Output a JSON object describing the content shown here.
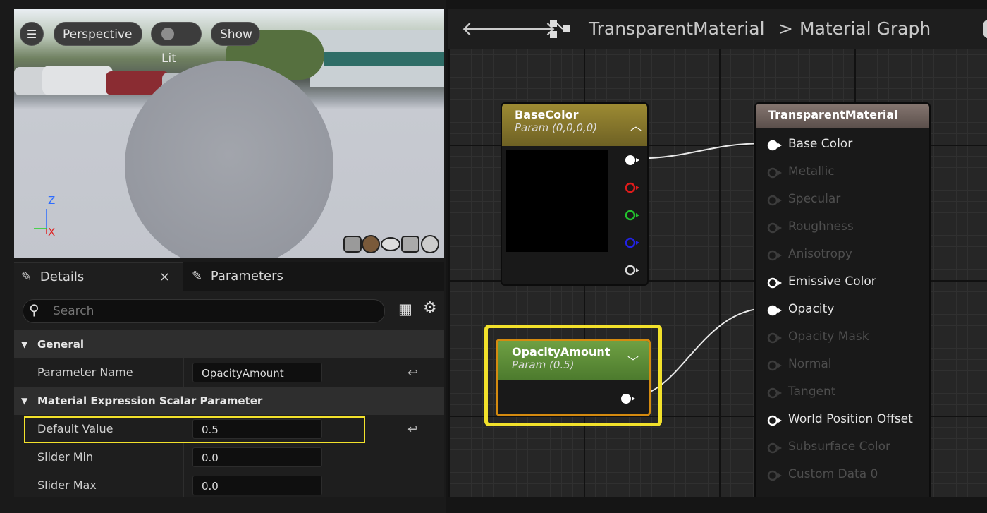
{
  "viewport": {
    "menu_icon": "hamburger-icon",
    "perspective_label": "Perspective",
    "lit_label": "Lit",
    "show_label": "Show",
    "axis_z": "Z",
    "axis_x": "X"
  },
  "details_panel": {
    "tab_details": "Details",
    "tab_close": "×",
    "tab_parameters": "Parameters",
    "search_placeholder": "Search",
    "section_general": "General",
    "section_scalar": "Material Expression Scalar Parameter",
    "properties": [
      {
        "label": "Parameter Name",
        "value": "OpacityAmount"
      },
      {
        "label": "Default Value",
        "value": "0.5"
      },
      {
        "label": "Slider Min",
        "value": "0.0"
      },
      {
        "label": "Slider Max",
        "value": "0.0"
      }
    ]
  },
  "graph": {
    "breadcrumb_root": "TransparentMaterial",
    "breadcrumb_sep": ">",
    "breadcrumb_leaf": "Material Graph",
    "base_color_node": {
      "title": "BaseColor",
      "subtitle": "Param (0,0,0,0)"
    },
    "opacity_node": {
      "title": "OpacityAmount",
      "subtitle": "Param (0.5)"
    },
    "result_node": {
      "title": "TransparentMaterial",
      "pins": [
        {
          "label": "Base Color",
          "active": true,
          "connected": true
        },
        {
          "label": "Metallic",
          "active": false
        },
        {
          "label": "Specular",
          "active": false
        },
        {
          "label": "Roughness",
          "active": false
        },
        {
          "label": "Anisotropy",
          "active": false
        },
        {
          "label": "Emissive Color",
          "active": true,
          "connected": false
        },
        {
          "label": "Opacity",
          "active": true,
          "connected": true
        },
        {
          "label": "Opacity Mask",
          "active": false
        },
        {
          "label": "Normal",
          "active": false
        },
        {
          "label": "Tangent",
          "active": false
        },
        {
          "label": "World Position Offset",
          "active": true,
          "connected": false
        },
        {
          "label": "Subsurface Color",
          "active": false
        },
        {
          "label": "Custom Data 0",
          "active": false
        }
      ]
    }
  },
  "colors": {
    "highlight": "#f2e12b",
    "base_color_header": "#8a7a2c",
    "opacity_header": "#5a8a38",
    "result_header": "#6c5e58",
    "pin_red": "#e01b1b",
    "pin_green": "#22c32d",
    "pin_blue": "#2222e6"
  }
}
